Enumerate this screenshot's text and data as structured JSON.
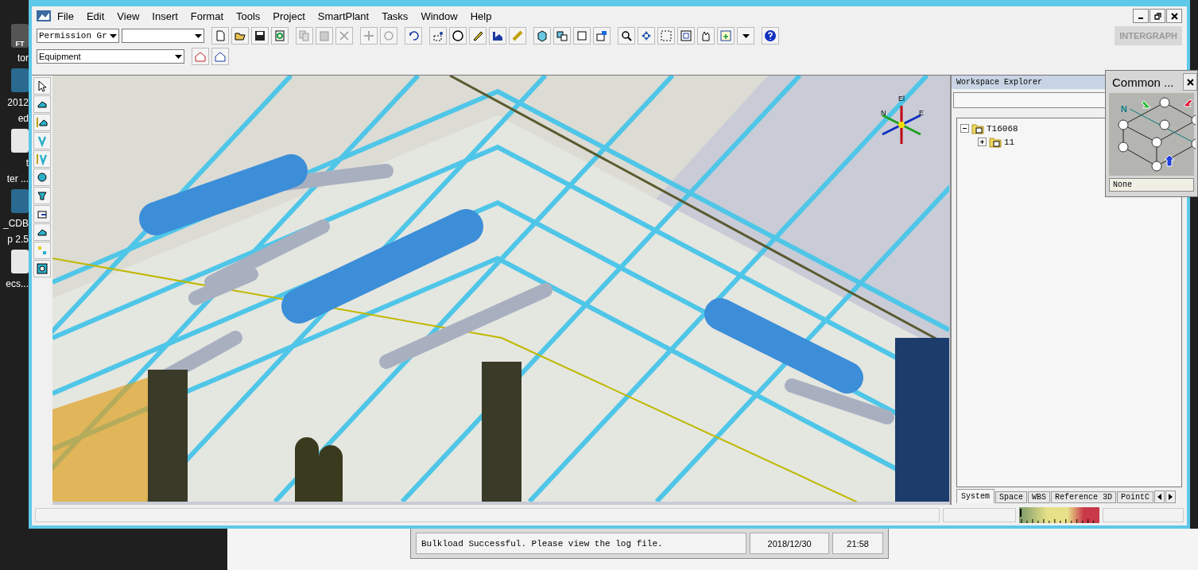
{
  "desktop_icons": [
    {
      "label": "tor",
      "caption": "FT"
    },
    {
      "label": "2012"
    },
    {
      "label": "ed"
    },
    {
      "label": "t"
    },
    {
      "label": "ter ..."
    },
    {
      "label": "_CDB"
    },
    {
      "label": "p 2.5"
    },
    {
      "label": "ecs..."
    }
  ],
  "menu": [
    "File",
    "Edit",
    "View",
    "Insert",
    "Format",
    "Tools",
    "Project",
    "SmartPlant",
    "Tasks",
    "Window",
    "Help"
  ],
  "toolbar": {
    "permission_group": "Permission Gr",
    "logo": "INTERGRAPH"
  },
  "locate_filter": {
    "value": "Equipment"
  },
  "viewport": {
    "compass": [
      "El",
      "N",
      "E"
    ]
  },
  "workspace_explorer": {
    "title": "Workspace Explorer",
    "tree": [
      {
        "label": "T16068",
        "expanded": true,
        "children": [
          {
            "label": "11",
            "expanded": false
          }
        ]
      }
    ],
    "tabs": [
      {
        "label": "System",
        "selected": true
      },
      {
        "label": "Space",
        "selected": false
      },
      {
        "label": "WBS",
        "selected": false
      },
      {
        "label": "Reference 3D",
        "selected": false
      },
      {
        "label": "PointC",
        "selected": false
      }
    ]
  },
  "common_views": {
    "title": "Common ...",
    "north_label": "N",
    "view": "None"
  },
  "message_window": {
    "message": "Bulkload Successful. Please view the log file.",
    "date": "2018/12/30",
    "time": "21:58"
  }
}
